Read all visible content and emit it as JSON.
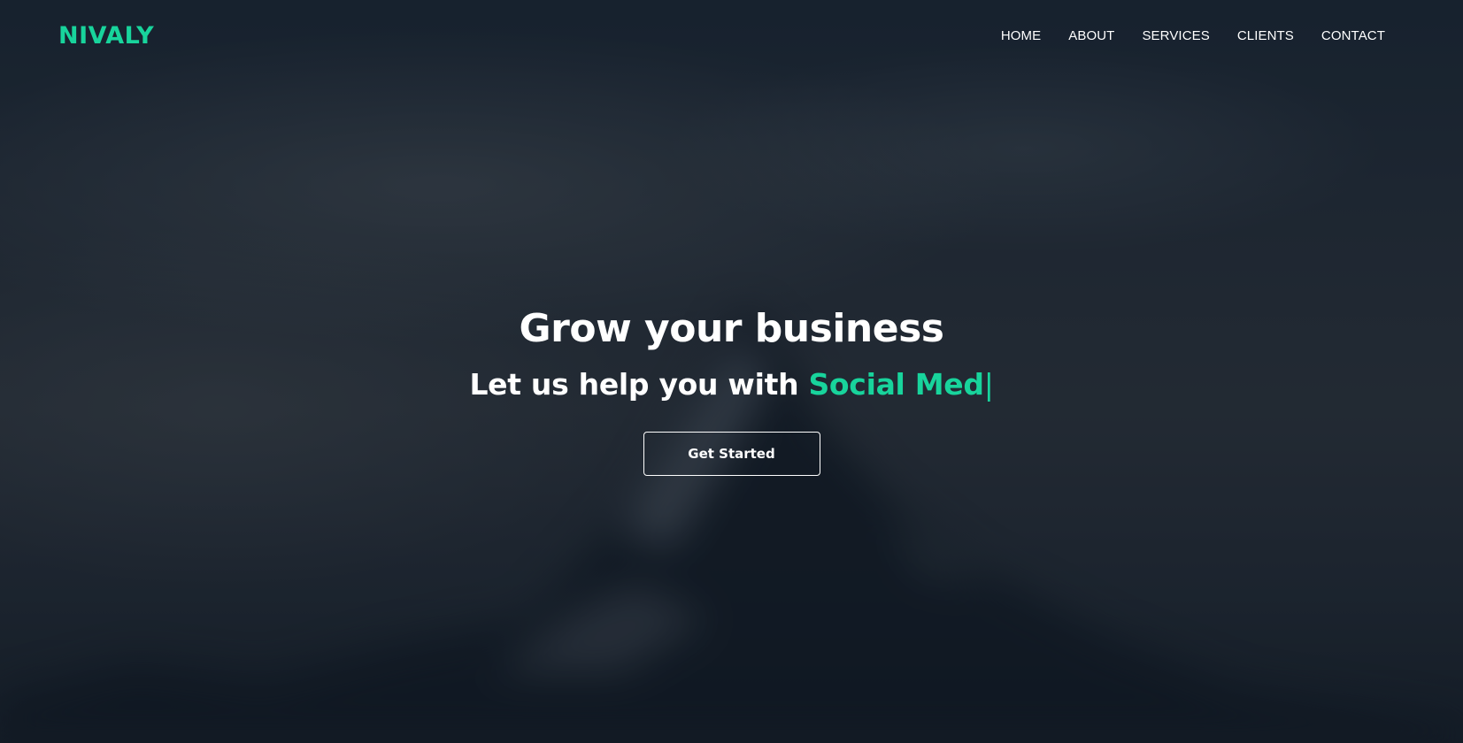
{
  "brand": {
    "name": "NIVALY",
    "accent_color": "#18d49c"
  },
  "nav": {
    "items": [
      {
        "label": "HOME"
      },
      {
        "label": "ABOUT"
      },
      {
        "label": "SERVICES"
      },
      {
        "label": "CLIENTS"
      },
      {
        "label": "CONTACT"
      }
    ]
  },
  "hero": {
    "title": "Grow your business",
    "subtitle_prefix": "Let us help you with",
    "typed_text": "Social Med",
    "cursor": "|",
    "cta_label": "Get Started"
  }
}
